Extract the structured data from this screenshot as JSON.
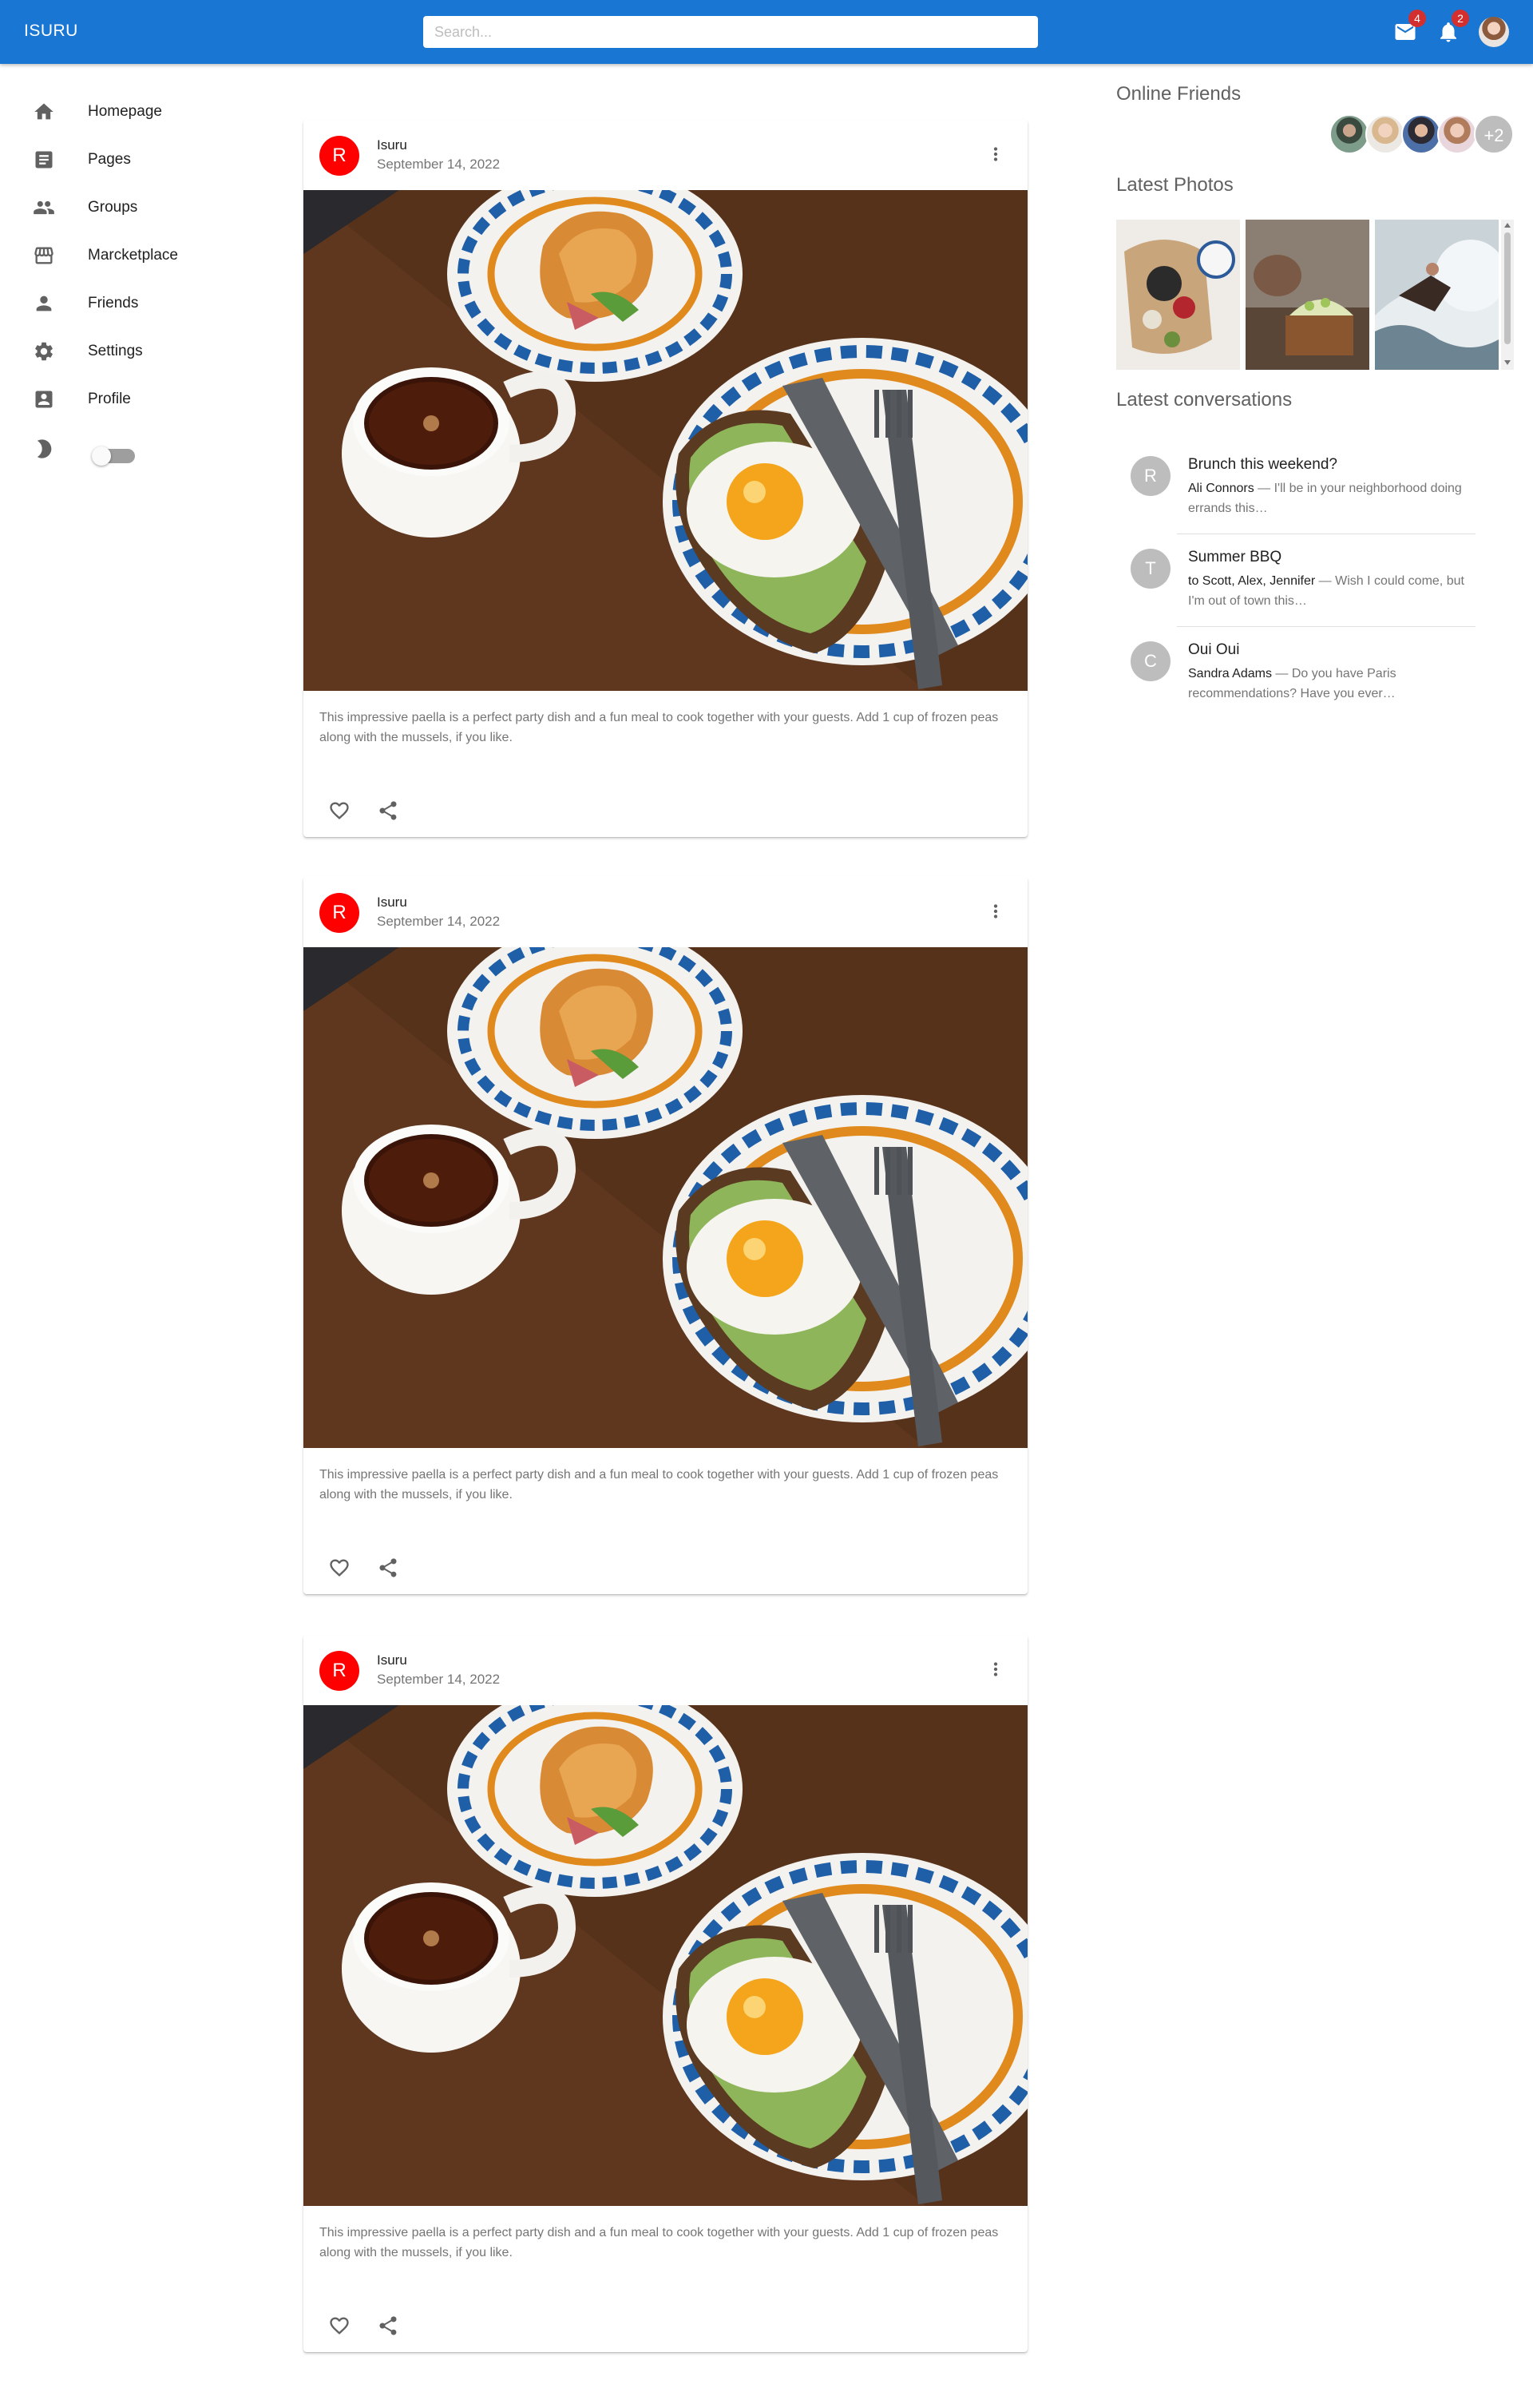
{
  "app": {
    "brand": "ISURU"
  },
  "search": {
    "placeholder": "Search..."
  },
  "topbar": {
    "mail_count": "4",
    "notif_count": "2"
  },
  "sidebar": {
    "items": [
      {
        "label": "Homepage",
        "icon": "home-icon"
      },
      {
        "label": "Pages",
        "icon": "article-icon"
      },
      {
        "label": "Groups",
        "icon": "group-icon"
      },
      {
        "label": "Marcketplace",
        "icon": "storefront-icon"
      },
      {
        "label": "Friends",
        "icon": "person-icon"
      },
      {
        "label": "Settings",
        "icon": "gear-icon"
      },
      {
        "label": "Profile",
        "icon": "profile-icon"
      }
    ],
    "theme_toggle": {
      "icon": "moon-icon",
      "on": false
    }
  },
  "posts": [
    {
      "avatar_letter": "R",
      "author": "Isuru",
      "date": "September 14, 2022",
      "text": "This impressive paella is a perfect party dish and a fun meal to cook together with your guests. Add 1 cup of frozen peas along with the mussels, if you like."
    },
    {
      "avatar_letter": "R",
      "author": "Isuru",
      "date": "September 14, 2022",
      "text": "This impressive paella is a perfect party dish and a fun meal to cook together with your guests. Add 1 cup of frozen peas along with the mussels, if you like."
    },
    {
      "avatar_letter": "R",
      "author": "Isuru",
      "date": "September 14, 2022",
      "text": "This impressive paella is a perfect party dish and a fun meal to cook together with your guests. Add 1 cup of frozen peas along with the mussels, if you like."
    }
  ],
  "right": {
    "online_friends_title": "Online Friends",
    "online_friends_more": "+2",
    "latest_photos_title": "Latest Photos",
    "latest_conversations_title": "Latest conversations",
    "conversations": [
      {
        "letter": "R",
        "title": "Brunch this weekend?",
        "sender": "Ali Connors",
        "snippet": " — I'll be in your neighborhood doing errands this…"
      },
      {
        "letter": "T",
        "title": "Summer BBQ",
        "sender": "to Scott, Alex, Jennifer",
        "snippet": " — Wish I could come, but I'm out of town this…"
      },
      {
        "letter": "C",
        "title": "Oui Oui",
        "sender": "Sandra Adams",
        "snippet": " — Do you have Paris recommendations? Have you ever…"
      }
    ]
  },
  "colors": {
    "appbar": "#1976d2",
    "post_avatar": "#ff0000",
    "badge": "#d32f2f"
  }
}
